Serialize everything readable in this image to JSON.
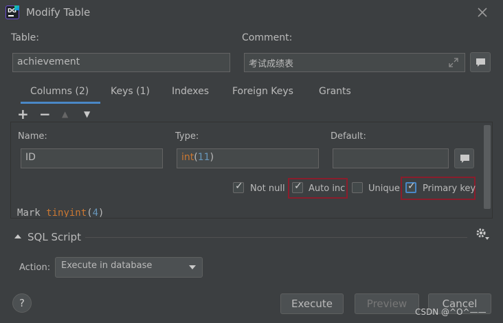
{
  "window": {
    "title": "Modify Table"
  },
  "table_field": {
    "label": "Table:",
    "value": "achievement"
  },
  "comment_field": {
    "label": "Comment:",
    "value": "考试成绩表"
  },
  "tabs": [
    {
      "label": "Columns (2)",
      "active": true
    },
    {
      "label": "Keys (1)",
      "active": false
    },
    {
      "label": "Indexes",
      "active": false
    },
    {
      "label": "Foreign Keys",
      "active": false
    },
    {
      "label": "Grants",
      "active": false
    }
  ],
  "toolbar": {
    "add": "+",
    "remove": "−",
    "up": "▲",
    "down": "▼"
  },
  "column_editor": {
    "name_label": "Name:",
    "name_value": "ID",
    "type_label": "Type:",
    "type_name": "int",
    "type_open": "(",
    "type_size": "11",
    "type_close": ")",
    "default_label": "Default:",
    "default_value": ""
  },
  "options": [
    {
      "label": "Not null",
      "checked": true
    },
    {
      "label": "Auto inc",
      "checked": true
    },
    {
      "label": "Unique",
      "checked": false
    },
    {
      "label": "Primary key",
      "checked": true
    }
  ],
  "next_column": {
    "name": "Mark",
    "type": "tinyint",
    "open": "(",
    "size": "4",
    "close": ")"
  },
  "sql_section": {
    "label": "SQL Script"
  },
  "action": {
    "label": "Action:",
    "selected": "Execute in database"
  },
  "buttons": {
    "execute": "Execute",
    "preview": "Preview",
    "cancel": "Cancel"
  },
  "watermark": "CSDN @^O^——",
  "colors": {
    "accent": "#4a88c7",
    "type_keyword": "#cc7832",
    "number": "#6897bb",
    "highlight": "#8b1d2c"
  }
}
